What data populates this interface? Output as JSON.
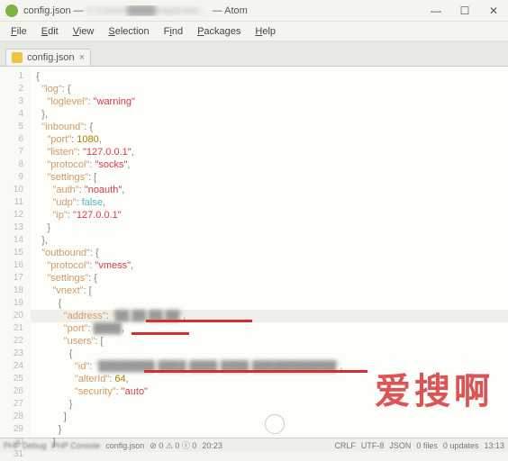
{
  "window": {
    "title_prefix": "config.json — ",
    "title_blur": "C:\\Users\\████\\AppData\\…",
    "title_suffix": " — Atom"
  },
  "menus": [
    "File",
    "Edit",
    "View",
    "Selection",
    "Find",
    "Packages",
    "Help"
  ],
  "tab": {
    "label": "config.json",
    "close": "×"
  },
  "gutter_lines": [
    "1",
    "2",
    "3",
    "4",
    "5",
    "6",
    "7",
    "8",
    "9",
    "10",
    "11",
    "12",
    "13",
    "14",
    "15",
    "16",
    "17",
    "18",
    "19",
    "20",
    "21",
    "22",
    "23",
    "24",
    "25",
    "26",
    "27",
    "28",
    "29",
    "30",
    "31"
  ],
  "code": {
    "l1": "{",
    "l2_key": "\"log\"",
    "l2_rest": ": {",
    "l3_key": "\"loglevel\"",
    "l3_val": "\"warning\"",
    "l4": "},",
    "l5_key": "\"inbound\"",
    "l5_rest": ": {",
    "l6_key": "\"port\"",
    "l6_val": "1080",
    "l7_key": "\"listen\"",
    "l7_val": "\"127.0.0.1\"",
    "l8_key": "\"protocol\"",
    "l8_val": "\"socks\"",
    "l9_key": "\"settings\"",
    "l9_rest": ": [",
    "l10_key": "\"auth\"",
    "l10_val": "\"noauth\"",
    "l11_key": "\"udp\"",
    "l11_val": "false",
    "l12_key": "\"ip\"",
    "l12_val": "\"127.0.0.1\"",
    "l13": "}",
    "l14": "},",
    "l15_key": "\"outbound\"",
    "l15_rest": ": {",
    "l16_key": "\"protocol\"",
    "l16_val": "\"vmess\"",
    "l17_key": "\"settings\"",
    "l17_rest": ": {",
    "l18_key": "\"vnext\"",
    "l18_rest": ": [",
    "l19": "{",
    "l20_key": "\"address\"",
    "l20_val": "\"██.██.██.██\"",
    "l21_key": "\"port\"",
    "l21_val": "████",
    "l22_key": "\"users\"",
    "l22_rest": ": [",
    "l23": "{",
    "l24_key": "\"id\"",
    "l24_val": "\"████████-████-████-████-████████████\"",
    "l25_key": "\"alterId\"",
    "l25_val": "64",
    "l26_key": "\"security\"",
    "l26_val": "\"auto\"",
    "l27": "}",
    "l28": "]",
    "l29": "}",
    "l30": "]",
    "l31": ""
  },
  "status": {
    "left1": "PHP Debug",
    "left2": "PHP Console",
    "file": "config.json",
    "diag": "⊘ 0 ⚠ 0 ⓘ 0",
    "cursor": "20:23",
    "crlf": "CRLF",
    "enc": "UTF-8",
    "lang": "JSON",
    "files": "0 files",
    "updates": "0 updates",
    "time": "13:13"
  },
  "watermark": "爱搜啊"
}
